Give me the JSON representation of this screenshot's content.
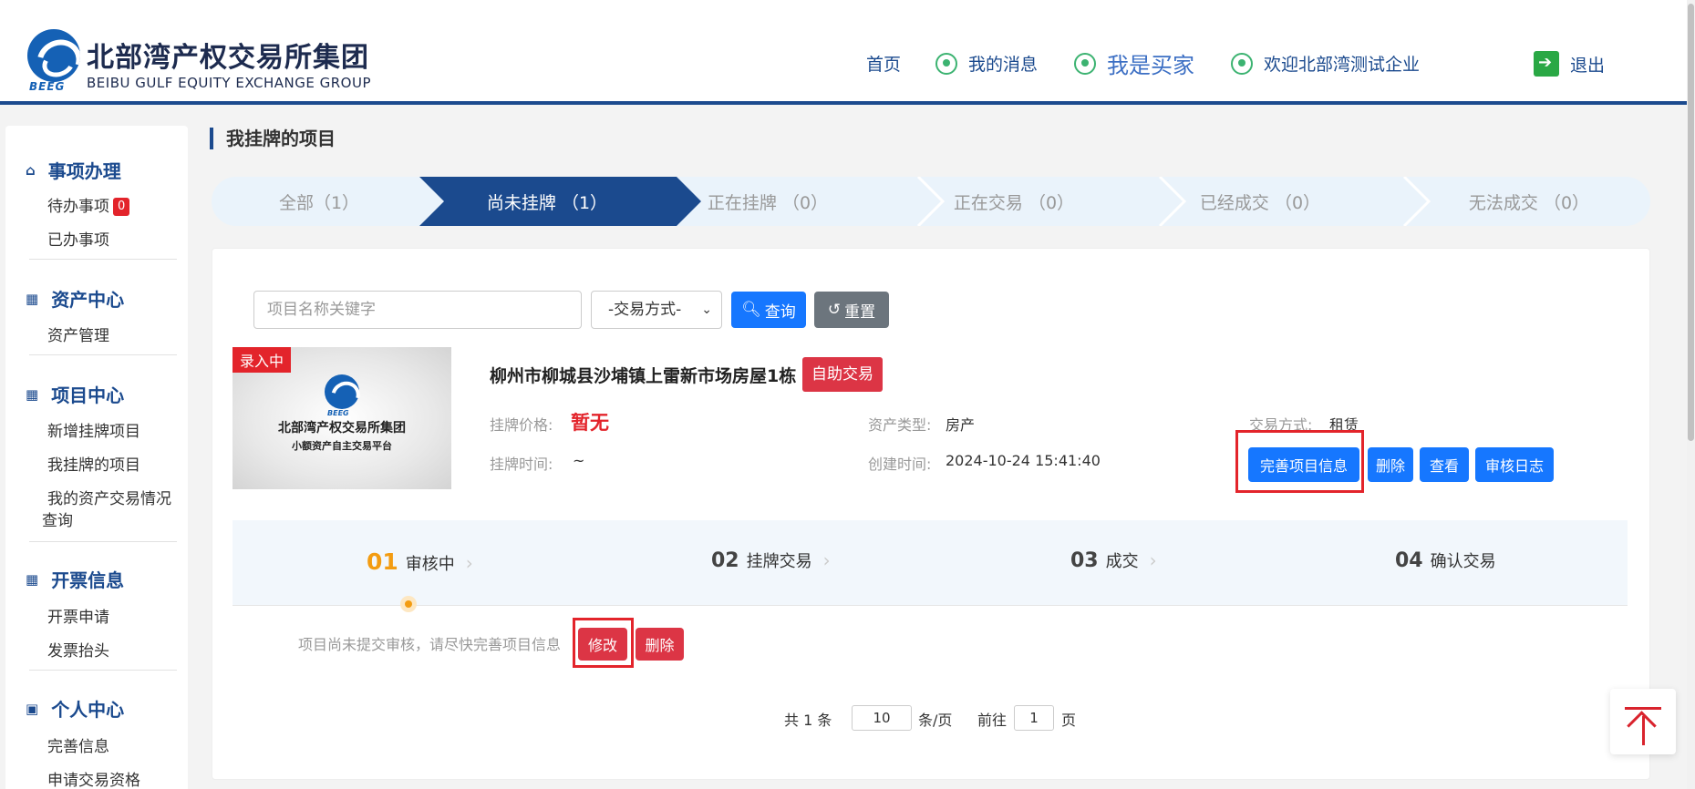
{
  "header": {
    "logo_cn": "北部湾产权交易所集团",
    "logo_en": "BEIBU GULF EQUITY EXCHANGE GROUP",
    "logo_abbr": "BEEG",
    "nav": {
      "home": "首页",
      "messages": "我的消息",
      "buyer": "我是买家",
      "welcome": "欢迎北部湾测试企业",
      "logout": "退出"
    }
  },
  "sidebar": {
    "sections": [
      {
        "title": "事项办理",
        "items": [
          "待办事项",
          "已办事项"
        ],
        "todo_badge": "0"
      },
      {
        "title": "资产中心",
        "items": [
          "资产管理"
        ]
      },
      {
        "title": "项目中心",
        "items": [
          "新增挂牌项目",
          "我挂牌的项目",
          "我的资产交易情况",
          "查询"
        ]
      },
      {
        "title": "开票信息",
        "items": [
          "开票申请",
          "发票抬头"
        ]
      },
      {
        "title": "个人中心",
        "items": [
          "完善信息",
          "申请交易资格"
        ]
      }
    ]
  },
  "main": {
    "title": "我挂牌的项目",
    "tabs": [
      {
        "label": "全部（1）"
      },
      {
        "label": "尚未挂牌 （1）"
      },
      {
        "label": "正在挂牌 （0）"
      },
      {
        "label": "正在交易 （0）"
      },
      {
        "label": "已经成交 （0）"
      },
      {
        "label": "无法成交 （0）"
      }
    ],
    "active_tab": 1,
    "search": {
      "placeholder": "项目名称关键字",
      "trade_mode": "-交易方式-",
      "query_btn": "查询",
      "reset_btn": "重置"
    },
    "item": {
      "status_tag": "录入中",
      "thumb_line1": "北部湾产权交易所集团",
      "thumb_line2": "小额资产自主交易平台",
      "thumb_abbr": "BEEG",
      "title": "柳州市柳城县沙埔镇上雷新市场房屋1栋",
      "type_tag": "自助交易",
      "price_label": "挂牌价格:",
      "price_value": "暂无",
      "asset_type_label": "资产类型:",
      "asset_type_value": "房产",
      "trade_mode_label": "交易方式:",
      "trade_mode_value": "租赁",
      "list_time_label": "挂牌时间:",
      "list_time_value": "~",
      "created_label": "创建时间:",
      "created_value": "2024-10-24 15:41:40",
      "actions": {
        "complete": "完善项目信息",
        "delete": "删除",
        "view": "查看",
        "audit_log": "审核日志"
      }
    },
    "progress": {
      "steps": [
        {
          "num": "01",
          "label": "审核中"
        },
        {
          "num": "02",
          "label": "挂牌交易"
        },
        {
          "num": "03",
          "label": "成交"
        },
        {
          "num": "04",
          "label": "确认交易"
        }
      ],
      "notice": "项目尚未提交审核，请尽快完善项目信息",
      "edit_btn": "修改",
      "delete_btn": "删除"
    },
    "pagination": {
      "total": "共 1 条",
      "page_size": "10",
      "per_page": "条/页",
      "goto": "前往",
      "page": "1",
      "page_unit": "页"
    }
  },
  "colors": {
    "brand_blue": "#1b4a8e",
    "button_blue": "#1677ff",
    "danger_red": "#dc3545",
    "step_orange": "#f39c12"
  }
}
